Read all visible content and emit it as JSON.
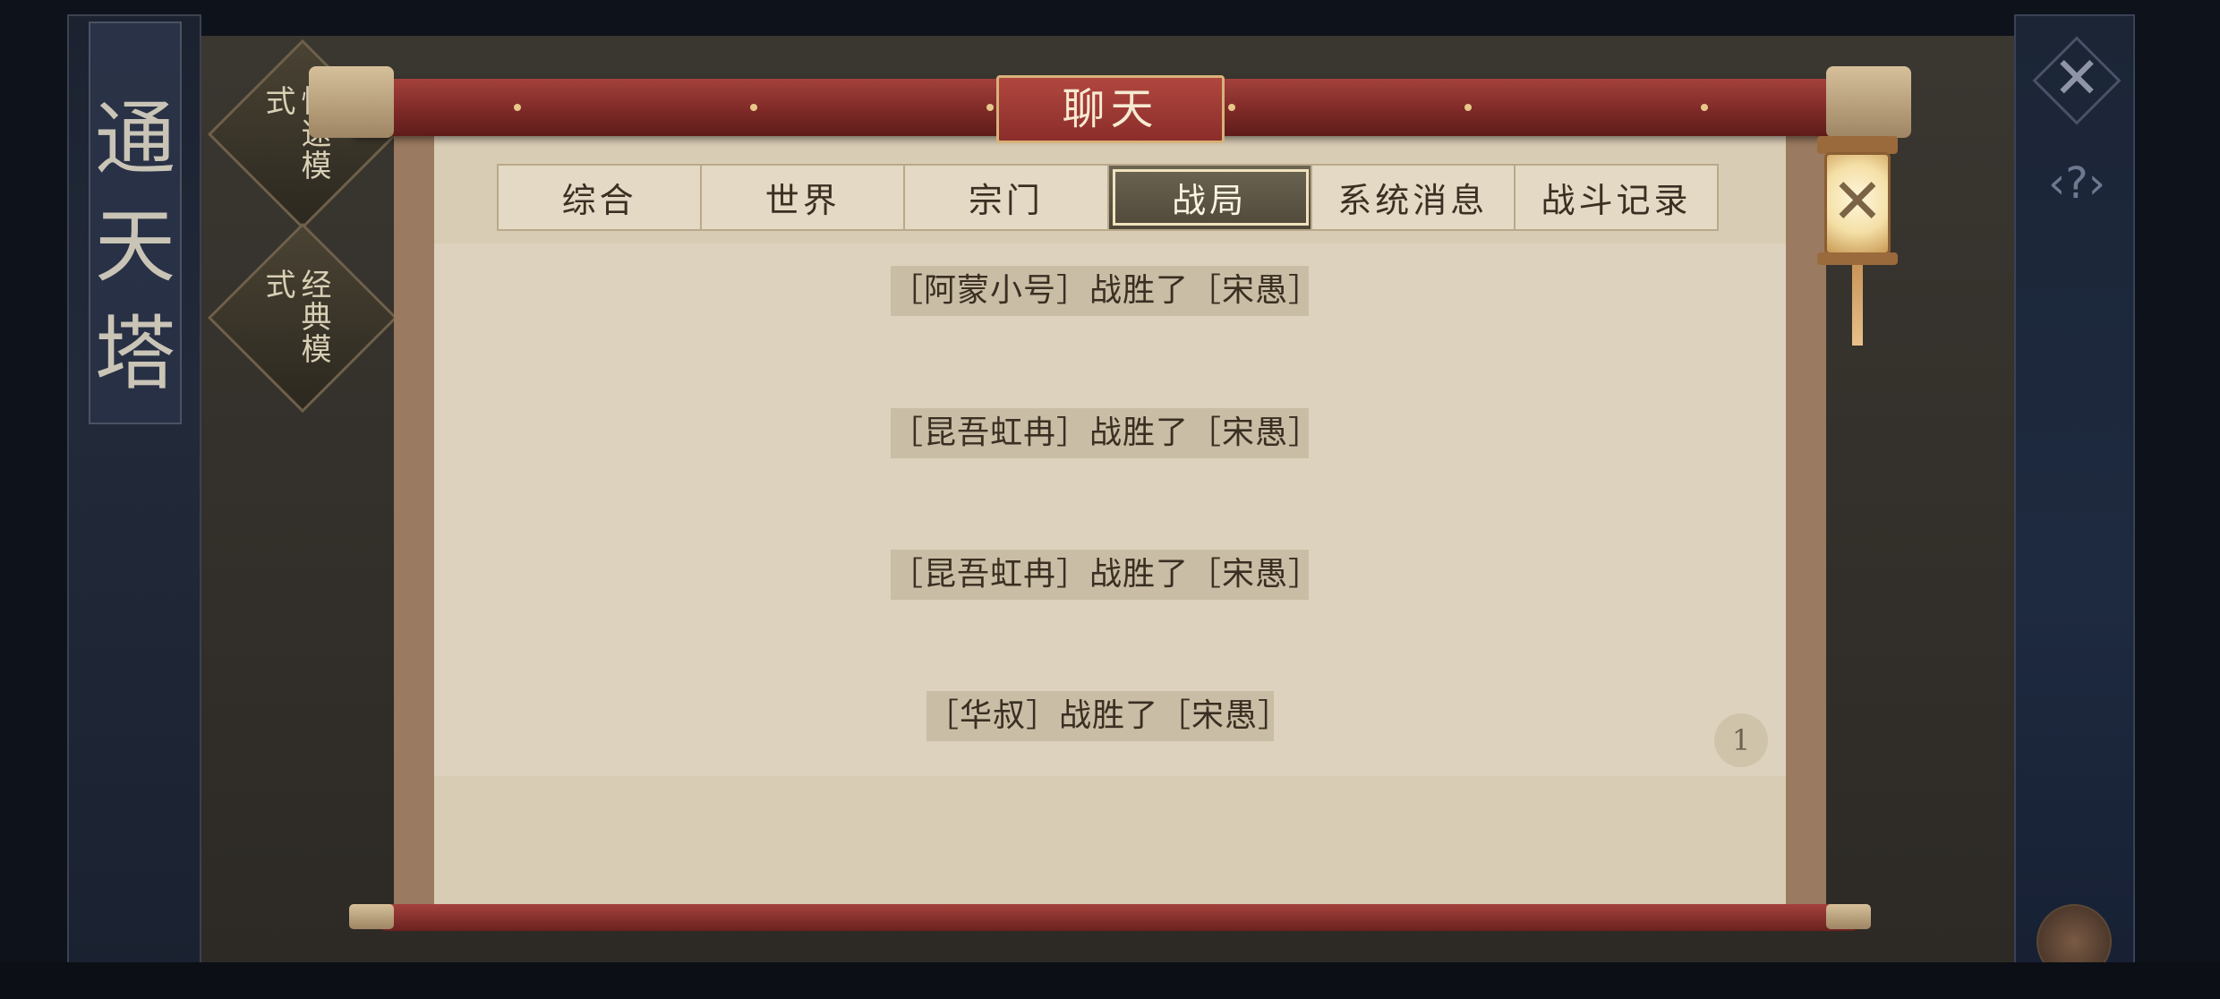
{
  "background": {
    "tower_title": [
      "通",
      "天",
      "塔"
    ],
    "modes": [
      {
        "label": "快速模式"
      },
      {
        "label": "经典模式"
      }
    ]
  },
  "dialog": {
    "title": "聊天",
    "tabs": [
      {
        "label": "综合",
        "active": false
      },
      {
        "label": "世界",
        "active": false
      },
      {
        "label": "宗门",
        "active": false
      },
      {
        "label": "战局",
        "active": true
      },
      {
        "label": "系统消息",
        "active": false
      },
      {
        "label": "战斗记录",
        "active": false
      }
    ],
    "messages": [
      "［阿蒙小号］战胜了［宋愚］",
      "［昆吾虹冉］战胜了［宋愚］",
      "［昆吾虹冉］战胜了［宋愚］",
      "［华叔］战胜了［宋愚］"
    ],
    "page_number": "1",
    "close_icon": "close-icon"
  },
  "colors": {
    "scroll_red": "#8b2d2a",
    "paper": "#d8ccb4",
    "active_tab": "#5a5242"
  }
}
